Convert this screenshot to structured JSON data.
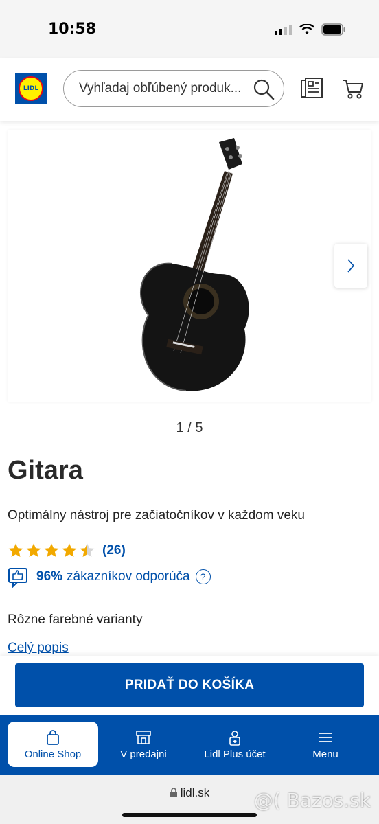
{
  "status_bar": {
    "time": "10:58"
  },
  "header": {
    "logo_text": "LIDL",
    "search_placeholder": "Vyhľadaj obľúbený produk..."
  },
  "gallery": {
    "pager": "1 / 5"
  },
  "product": {
    "title": "Gitara",
    "subtitle": "Optimálny nástroj pre začiatočníkov v každom veku",
    "rating_value": 4.5,
    "rating_count": "(26)",
    "recommend_pct": "96%",
    "recommend_text": "zákazníkov odporúča",
    "help_symbol": "?",
    "variants_text": "Rôzne farebné varianty",
    "full_description_link": "Celý popis"
  },
  "cta": {
    "label": "PRIDAŤ DO KOŠÍKA"
  },
  "bottom_nav": {
    "items": [
      {
        "label": "Online Shop",
        "icon": "shopping-bag-icon",
        "active": true
      },
      {
        "label": "V predajni",
        "icon": "store-icon",
        "active": false
      },
      {
        "label": "Lidl Plus účet",
        "icon": "lidl-plus-account-icon",
        "active": false
      },
      {
        "label": "Menu",
        "icon": "hamburger-menu-icon",
        "active": false
      }
    ]
  },
  "browser": {
    "url": "lidl.sk"
  },
  "watermark": "@( Bazos.sk",
  "colors": {
    "brand_blue": "#0050aa",
    "star": "#f2a900",
    "logo_yellow": "#fff000",
    "logo_red": "#e60a14"
  }
}
